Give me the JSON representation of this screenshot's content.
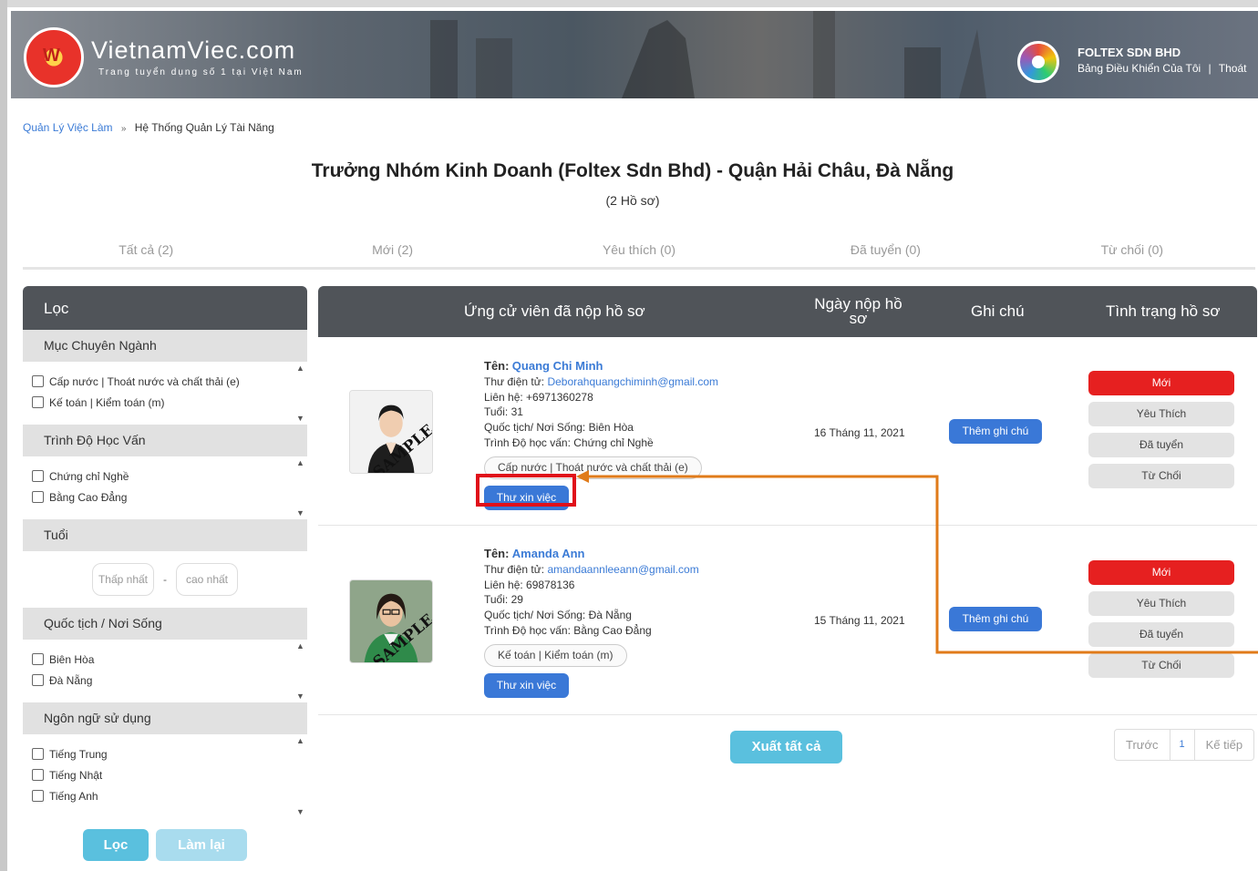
{
  "header": {
    "logo_text": "VietnamViec.com",
    "logo_sub": "Trang tuyển dụng số 1 tại Việt Nam",
    "logo_letter": "W",
    "company_name": "FOLTEX SDN BHD",
    "dashboard_link": "Bảng Điều Khiển Của Tôi",
    "separator": "|",
    "logout_link": "Thoát"
  },
  "breadcrumb": {
    "root": "Quản Lý Việc Làm",
    "sep": "»",
    "current": "Hệ Thống Quản Lý Tài Năng"
  },
  "job": {
    "title": "Trưởng Nhóm Kinh Doanh (Foltex Sdn Bhd) - Quận Hải Châu, Đà Nẵng",
    "count": "(2 Hồ sơ)"
  },
  "tabs": [
    "Tất cả (2)",
    "Mới (2)",
    "Yêu thích (0)",
    "Đã tuyển (0)",
    "Từ chối (0)"
  ],
  "filter": {
    "title": "Lọc",
    "sections": {
      "industry": {
        "title": "Mục Chuyên Ngành",
        "items": [
          "Cấp nước | Thoát nước và chất thải (e)",
          "Kế toán | Kiểm toán (m)"
        ]
      },
      "education": {
        "title": "Trình Độ Học Vấn",
        "items": [
          "Chứng chỉ Nghề",
          "Bằng Cao Đẳng"
        ]
      },
      "age": {
        "title": "Tuổi",
        "min_placeholder": "Thấp nhất",
        "dash": "-",
        "max_placeholder": "cao nhất"
      },
      "location": {
        "title": "Quốc tịch / Nơi Sống",
        "items": [
          "Biên Hòa",
          "Đà Nẵng"
        ]
      },
      "language": {
        "title": "Ngôn ngữ sử dụng",
        "items": [
          "Tiếng Trung",
          "Tiếng Nhật",
          "Tiếng Anh"
        ]
      }
    },
    "filter_button": "Lọc",
    "reset_button": "Làm lại"
  },
  "table": {
    "headers": {
      "candidate": "Ứng cử viên đã nộp hồ sơ",
      "date": "Ngày nộp hồ sơ",
      "note": "Ghi chú",
      "status": "Tình trạng hồ sơ"
    },
    "rows": [
      {
        "name_label": "Tên:",
        "name": "Quang Chi Minh",
        "email_label": "Thư điện tử:",
        "email": "Deborahquangchiminh@gmail.com",
        "phone": "Liên hệ: +6971360278",
        "age": "Tuổi: 31",
        "location": "Quốc tịch/ Nơi Sống: Biên Hòa",
        "education": "Trình Độ học vấn: Chứng chỉ Nghề",
        "tag": "Cấp nước | Thoát nước và chất thải (e)",
        "cv_button": "Thư xin việc",
        "date": "16 Tháng 11, 2021",
        "note_button": "Thêm ghi chú",
        "photo_label": "SAMPLE",
        "statuses": [
          "Mới",
          "Yêu Thích",
          "Đã tuyển",
          "Từ Chối"
        ]
      },
      {
        "name_label": "Tên:",
        "name": "Amanda Ann",
        "email_label": "Thư điện tử:",
        "email": "amandaannleeann@gmail.com",
        "phone": "Liên hệ: 69878136",
        "age": "Tuổi: 29",
        "location": "Quốc tịch/ Nơi Sống: Đà Nẵng",
        "education": "Trình Độ học vấn: Bằng Cao Đẳng",
        "tag": "Kế toán | Kiểm toán (m)",
        "cv_button": "Thư xin việc",
        "date": "15 Tháng 11, 2021",
        "note_button": "Thêm ghi chú",
        "photo_label": "SAMPLE",
        "statuses": [
          "Mới",
          "Yêu Thích",
          "Đã tuyển",
          "Từ Chối"
        ]
      }
    ]
  },
  "export_button": "Xuất tất cả",
  "pager": {
    "prev": "Trước",
    "current": "1",
    "next": "Kế tiếp"
  },
  "colors": {
    "accent": "#3a78d7",
    "status_new": "#e62020",
    "annotation_box": "#e0101a",
    "annotation_arrow": "#e07b1a"
  }
}
